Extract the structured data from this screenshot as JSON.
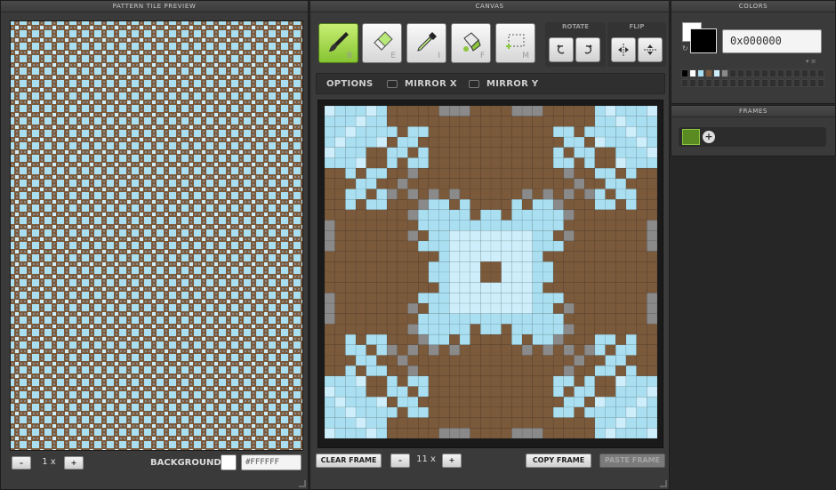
{
  "preview": {
    "title": "PATTERN TILE PREVIEW",
    "zoom_minus": "–",
    "zoom_value": "1 x",
    "zoom_plus": "+",
    "background_label": "BACKGROUND",
    "background_value": "#FFFFFF"
  },
  "canvas": {
    "title": "CANVAS",
    "tools": [
      {
        "key": "B",
        "icon": "brush-icon"
      },
      {
        "key": "E",
        "icon": "eraser-icon"
      },
      {
        "key": "I",
        "icon": "eyedropper-icon"
      },
      {
        "key": "F",
        "icon": "bucket-icon"
      },
      {
        "key": "M",
        "icon": "marquee-icon"
      }
    ],
    "rotate_label": "ROTATE",
    "flip_label": "FLIP",
    "options_label": "OPTIONS",
    "mirror_x_label": "MIRROR X",
    "mirror_y_label": "MIRROR Y",
    "clear_frame": "CLEAR FRAME",
    "zoom_minus": "–",
    "zoom_value": "11 x",
    "zoom_plus": "+",
    "copy_frame": "COPY FRAME",
    "paste_frame": "PASTE FRAME"
  },
  "colors": {
    "title": "COLORS",
    "hex_value": "0x000000",
    "current": "#000000",
    "swatches": [
      "#000000",
      "#ffffff",
      "#a9dff0",
      "#7b5a3c",
      "#cdeefa",
      "#8a8a8a"
    ]
  },
  "frames": {
    "title": "FRAMES",
    "add_label": "+"
  },
  "palette": {
    "brown": "#7b5a3c",
    "light_blue": "#a9dff0",
    "pale_blue": "#cdeefa",
    "gray": "#8a8a8a"
  }
}
